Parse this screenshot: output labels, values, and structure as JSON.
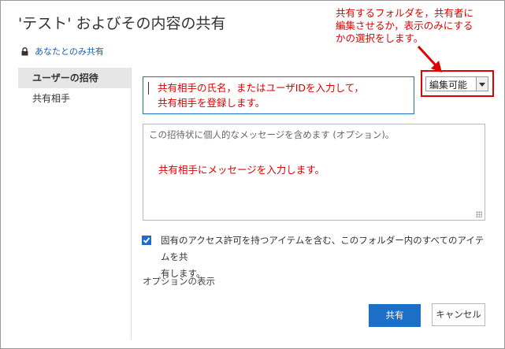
{
  "dialog": {
    "title": "'テスト' およびその内容の共有",
    "permission_note": "あなたとのみ共有",
    "icons": {
      "lock": "lock-icon",
      "check": "checkmark-icon",
      "dropdown": "chevron-down-icon",
      "resize": "resize-grip-icon"
    }
  },
  "nav": {
    "items": [
      {
        "label": "ユーザーの招待",
        "active": true
      },
      {
        "label": "共有相手",
        "active": false
      }
    ]
  },
  "invite": {
    "people_hint_line1": "共有相手の氏名，またはユーザIDを入力して，",
    "people_hint_line2": "共有相手を登録します。",
    "permission_value": "編集可能",
    "message_placeholder": "この招待状に個人的なメッセージを含めます (オプション)。",
    "message_hint": "共有相手にメッセージを入力します。",
    "include_items_checked": true,
    "include_items_label_line1": "固有のアクセス許可を持つアイテムを含む、このフォルダー内のすべてのアイテムを共",
    "include_items_label_line2": "有します。",
    "show_options": "オプションの表示"
  },
  "annotation": {
    "line1": "共有するフォルダを，共有者に",
    "line2": "編集させるか，表示のみにする",
    "line3": "かの選択をします。",
    "color": "#e00000"
  },
  "buttons": {
    "share": "共有",
    "cancel": "キャンセル"
  },
  "colors": {
    "accent": "#1c6fc7",
    "annotation": "#e00000"
  }
}
